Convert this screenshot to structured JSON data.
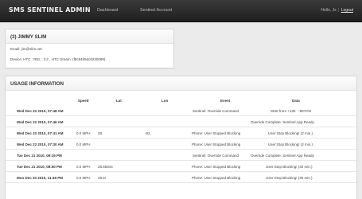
{
  "header": {
    "brand": "SMS SENTINEL ADMIN",
    "nav": [
      "Dashboard",
      "Sentinel Account"
    ],
    "hello": "Hello,",
    "user": "Js",
    "separator": "|",
    "logout": "Logout"
  },
  "profile": {
    "title": "(3) JIMMY SLIM",
    "email": "Email: jim@slim.net",
    "device": "Device: HTC : REL : 2.2 , HTC Dream: (f8c94b5dc0230099)"
  },
  "usage": {
    "title": "USAGE INFORMATION",
    "columns": [
      "Speed",
      "Lat",
      "Lon",
      "Event",
      "Data"
    ],
    "rows": [
      {
        "date": "Wed Dec 22 2010, 07:48 AM",
        "speed": "",
        "lat": "",
        "lon": "",
        "event": "Sentinel: Override Command",
        "data": "SMS from +135 · :99?ON"
      },
      {
        "date": "Wed Dec 22 2010, 07:46 AM",
        "speed": "",
        "lat": "",
        "lon": "",
        "event": "",
        "data": "Override Complete: Sentinel App Ready"
      },
      {
        "date": "Wed Dec 22 2010, 07:41 AM",
        "speed": "0.0 MPH",
        "lat": "28.",
        "lon": "-82.",
        "event": "Phone: User Stopped Blocking",
        "data": "User:Stop Blocking! (2 min.)"
      },
      {
        "date": "Wed Dec 22 2010, 07:30 AM",
        "speed": "0.0 MPH",
        "lat": "",
        "lon": "",
        "event": "Phone: User Stopped Blocking",
        "data": "User:Stop Blocking! (2 min.)"
      },
      {
        "date": "Tue Dec 21 2010, 09:19 PM",
        "speed": "",
        "lat": "",
        "lon": "",
        "event": "Sentinel: Override Command",
        "data": "Override Complete: Sentinel App Ready"
      },
      {
        "date": "Tue Dec 21 2010, 08:50 PM",
        "speed": "0.0 MPH",
        "lat": "28.65944",
        "lon": "",
        "event": "Phone: User Stopped Blocking",
        "data": "User:Stop Blocking! (30 min.)"
      },
      {
        "date": "Mon Dec 20 2010, 11:49 PM",
        "speed": "0.0 MPH",
        "lat": "28.6!",
        "lon": "",
        "event": "Phone: User Stopped Blocking",
        "data": "User:Stop Blocking! (30 min.)"
      }
    ]
  }
}
